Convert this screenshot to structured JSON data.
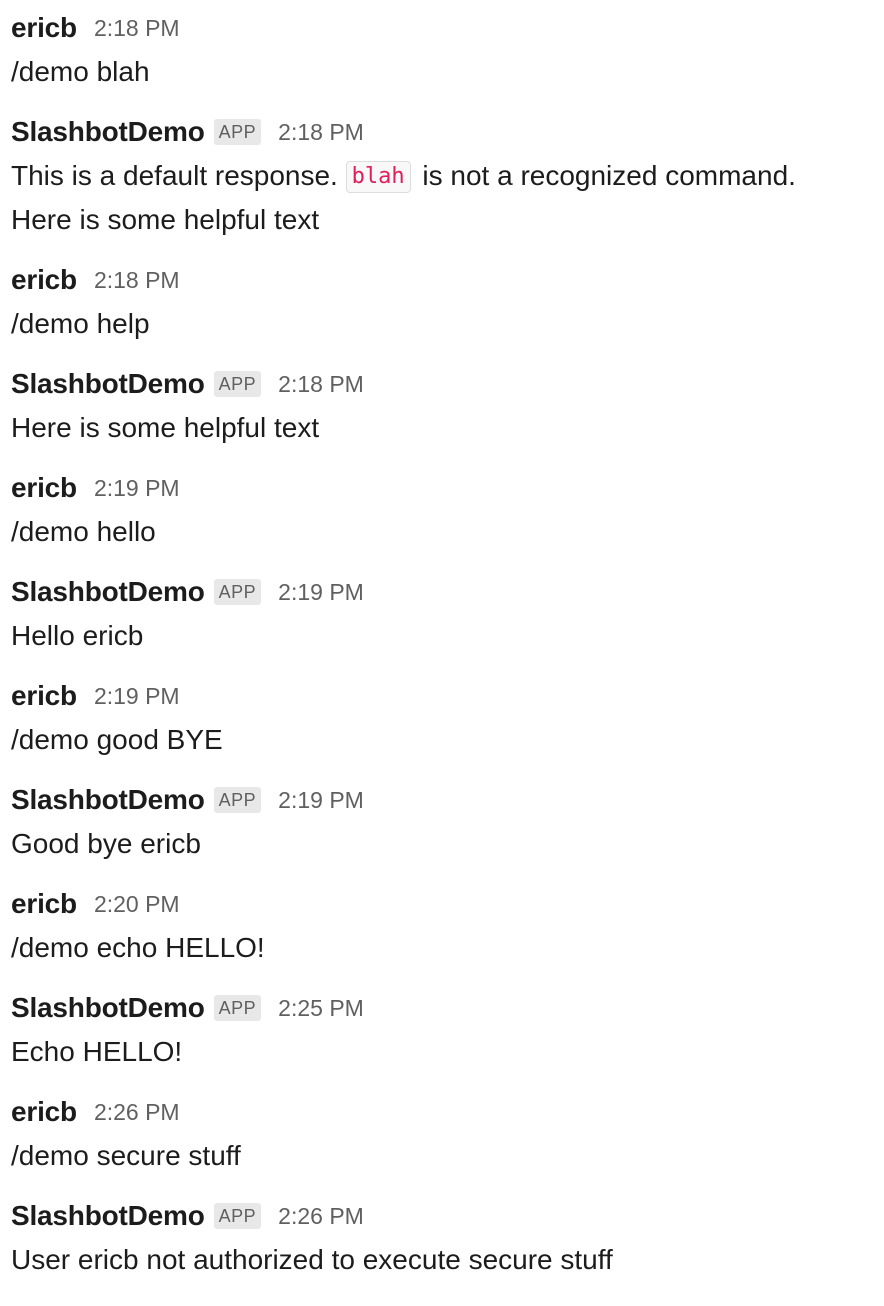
{
  "messages": [
    {
      "sender": "ericb",
      "time": "2:18 PM",
      "is_app": false,
      "lines": [
        [
          "/demo blah"
        ]
      ]
    },
    {
      "sender": "SlashbotDemo",
      "time": "2:18 PM",
      "is_app": true,
      "lines": [
        [
          "This is a default response. ",
          {
            "code": "blah"
          },
          " is not a recognized command."
        ],
        [
          "Here is some helpful text"
        ]
      ]
    },
    {
      "sender": "ericb",
      "time": "2:18 PM",
      "is_app": false,
      "lines": [
        [
          "/demo help"
        ]
      ]
    },
    {
      "sender": "SlashbotDemo",
      "time": "2:18 PM",
      "is_app": true,
      "lines": [
        [
          "Here is some helpful text"
        ]
      ]
    },
    {
      "sender": "ericb",
      "time": "2:19 PM",
      "is_app": false,
      "lines": [
        [
          "/demo hello"
        ]
      ]
    },
    {
      "sender": "SlashbotDemo",
      "time": "2:19 PM",
      "is_app": true,
      "lines": [
        [
          "Hello ericb"
        ]
      ]
    },
    {
      "sender": "ericb",
      "time": "2:19 PM",
      "is_app": false,
      "lines": [
        [
          "/demo good BYE"
        ]
      ]
    },
    {
      "sender": "SlashbotDemo",
      "time": "2:19 PM",
      "is_app": true,
      "lines": [
        [
          "Good bye ericb"
        ]
      ]
    },
    {
      "sender": "ericb",
      "time": "2:20 PM",
      "is_app": false,
      "lines": [
        [
          "/demo echo HELLO!"
        ]
      ]
    },
    {
      "sender": "SlashbotDemo",
      "time": "2:25 PM",
      "is_app": true,
      "lines": [
        [
          "Echo HELLO!"
        ]
      ]
    },
    {
      "sender": "ericb",
      "time": "2:26 PM",
      "is_app": false,
      "lines": [
        [
          "/demo secure stuff"
        ]
      ]
    },
    {
      "sender": "SlashbotDemo",
      "time": "2:26 PM",
      "is_app": true,
      "lines": [
        [
          "User ericb not authorized to execute secure stuff"
        ]
      ]
    }
  ],
  "app_badge_label": "APP"
}
